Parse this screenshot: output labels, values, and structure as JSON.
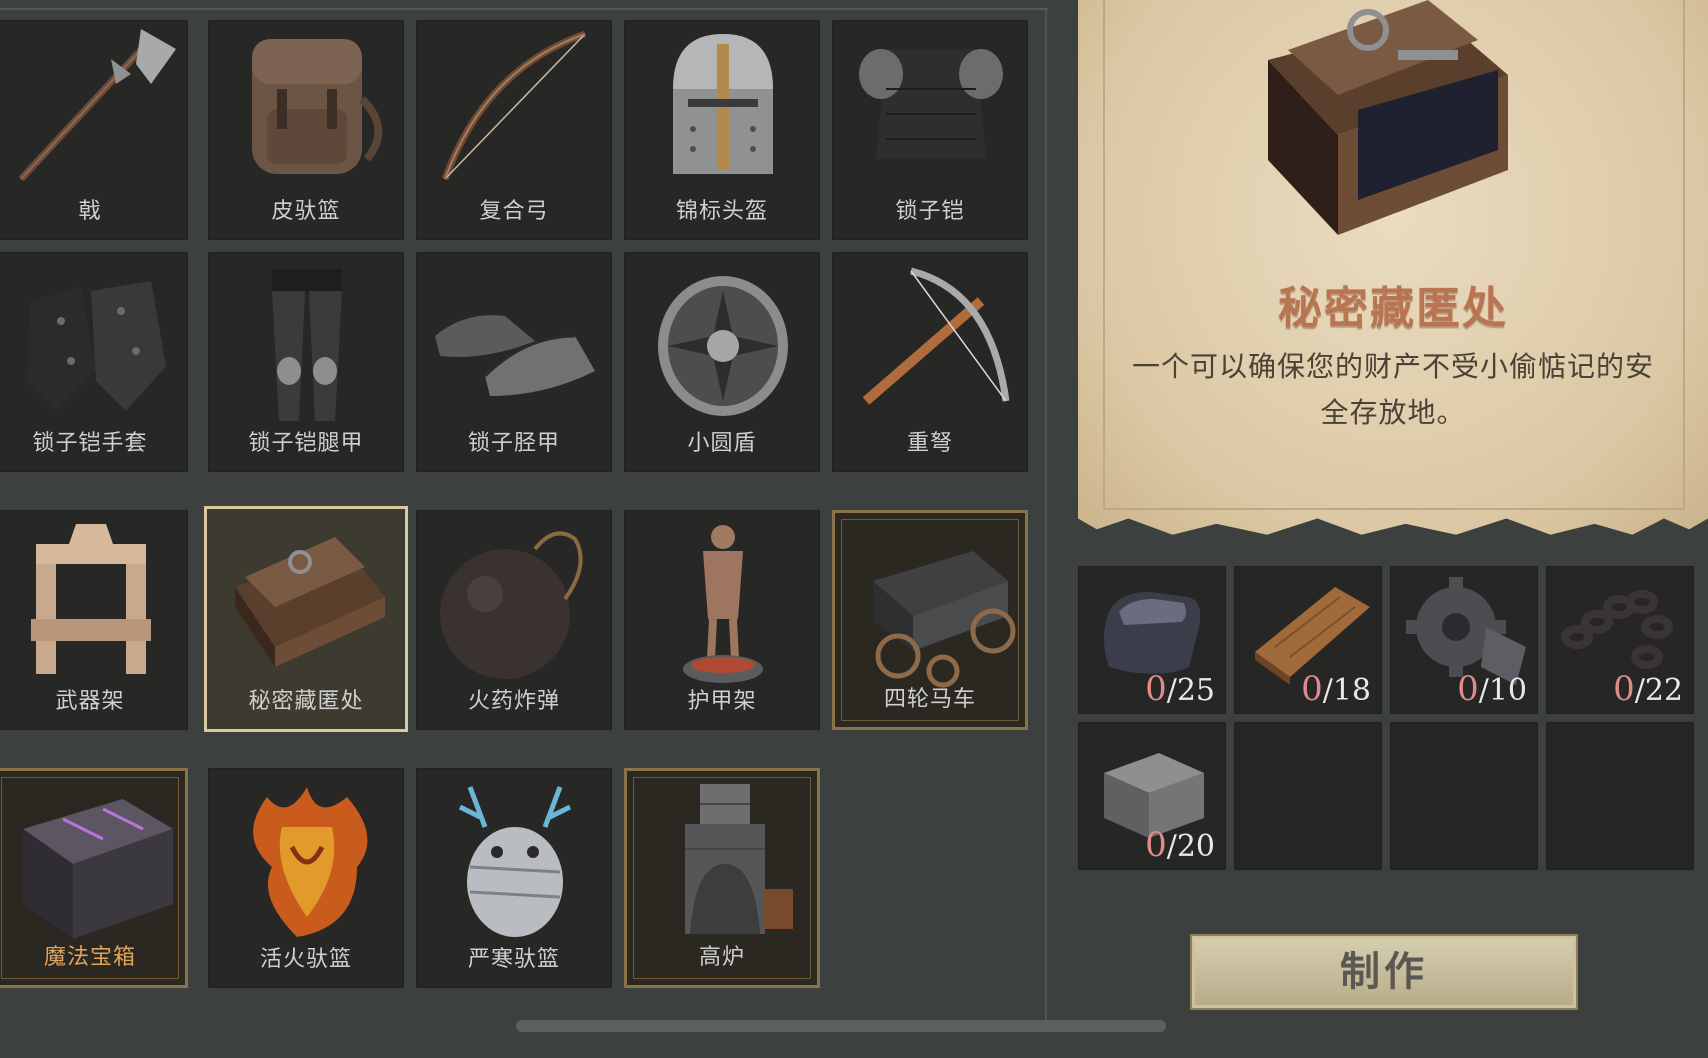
{
  "items": [
    {
      "label": "戟",
      "icon": "halberd-icon"
    },
    {
      "label": "皮驮篮",
      "icon": "leather-pack-icon"
    },
    {
      "label": "复合弓",
      "icon": "composite-bow-icon"
    },
    {
      "label": "锦标头盔",
      "icon": "tournament-helmet-icon"
    },
    {
      "label": "锁子铠",
      "icon": "chainmail-armor-icon"
    },
    {
      "label": "锁子铠手套",
      "icon": "chainmail-gloves-icon"
    },
    {
      "label": "锁子铠腿甲",
      "icon": "chainmail-leggings-icon"
    },
    {
      "label": "锁子胫甲",
      "icon": "chainmail-boots-icon"
    },
    {
      "label": "小圆盾",
      "icon": "round-shield-icon"
    },
    {
      "label": "重弩",
      "icon": "heavy-crossbow-icon"
    },
    {
      "label": "武器架",
      "icon": "weapon-rack-icon"
    },
    {
      "label": "秘密藏匿处",
      "icon": "secret-stash-icon"
    },
    {
      "label": "火药炸弹",
      "icon": "bomb-icon"
    },
    {
      "label": "护甲架",
      "icon": "armor-stand-icon"
    },
    {
      "label": "四轮马车",
      "icon": "wagon-icon"
    },
    {
      "label": "魔法宝箱",
      "icon": "magic-chest-icon"
    },
    {
      "label": "活火驮篮",
      "icon": "living-fire-pack-icon"
    },
    {
      "label": "严寒驮篮",
      "icon": "frost-pack-icon"
    },
    {
      "label": "高炉",
      "icon": "blast-furnace-icon"
    }
  ],
  "selected": {
    "title": "秘密藏匿处",
    "description": "一个可以确保您的财产不受小偷惦记的安全存放地。"
  },
  "materials": [
    {
      "icon": "iron-ingot-icon",
      "have": "0",
      "need": "/25"
    },
    {
      "icon": "wood-plank-icon",
      "have": "0",
      "need": "/18"
    },
    {
      "icon": "gear-icon",
      "have": "0",
      "need": "/10"
    },
    {
      "icon": "chain-icon",
      "have": "0",
      "need": "/22"
    },
    {
      "icon": "stone-block-icon",
      "have": "0",
      "need": "/20"
    }
  ],
  "craft_label": "制作",
  "colors": {
    "background": "#3c403e",
    "cell": "#272726",
    "gold_border": "#8a7348",
    "selected_border": "#d8c9a0",
    "title": "#b97552"
  }
}
